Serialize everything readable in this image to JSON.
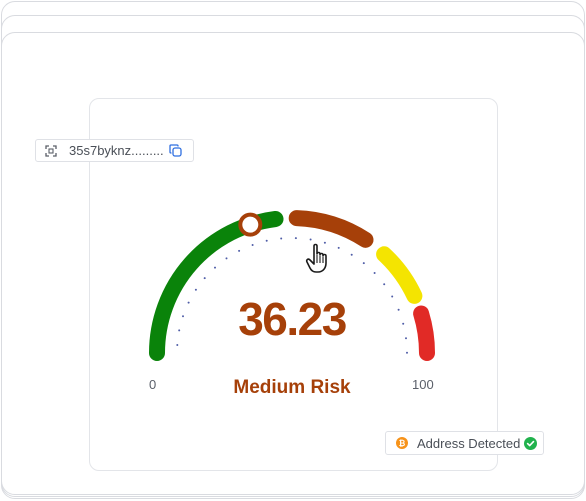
{
  "address_chip": {
    "icon": "scan-icon",
    "value": "35s7byknz.........",
    "copy_icon": "copy-icon"
  },
  "gauge": {
    "min_label": "0",
    "max_label": "100",
    "score": "36.23",
    "score_value": 36.23,
    "risk_label": "Medium Risk",
    "risk_color": "#a64009",
    "segments": [
      {
        "name": "low",
        "color": "#0a830a"
      },
      {
        "name": "medium",
        "color": "#a64009"
      },
      {
        "name": "elevated",
        "color": "#f4e401"
      },
      {
        "name": "high",
        "color": "#e12a26"
      }
    ],
    "tick_color": "#4f5da7"
  },
  "status_chip": {
    "coin_icon": "bitcoin-icon",
    "label": "Address Detected",
    "check_icon": "check-circle-icon",
    "coin_color": "#f7931a",
    "check_color": "#21b24d"
  }
}
